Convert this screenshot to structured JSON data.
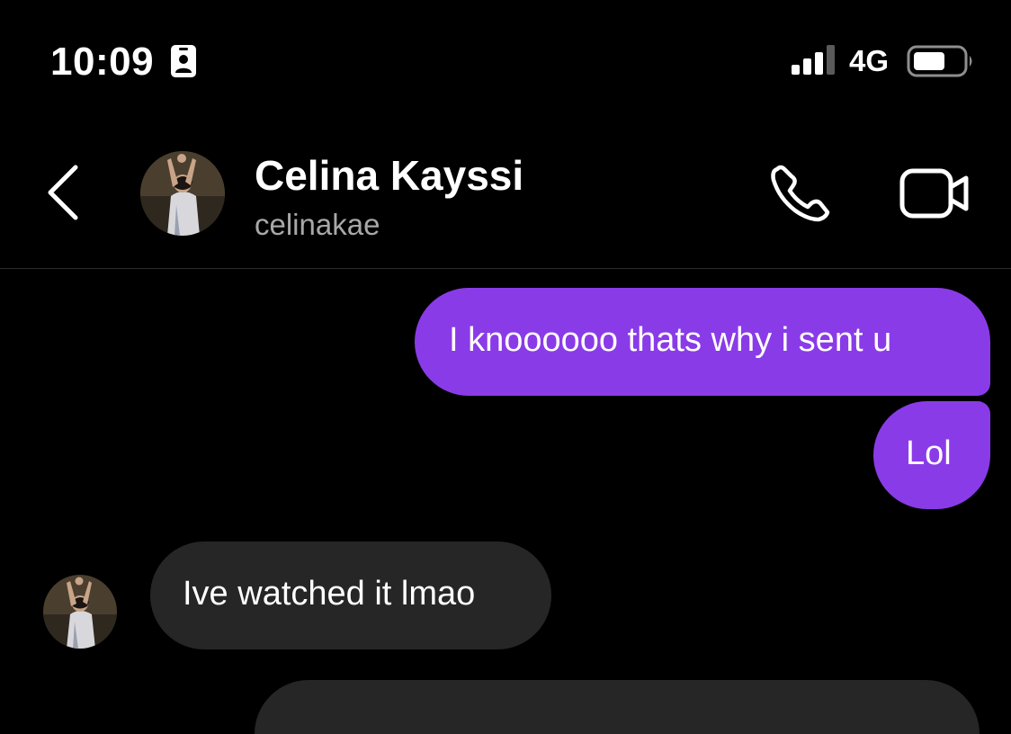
{
  "status_bar": {
    "time": "10:09",
    "network": "4G",
    "icons": [
      "contact-card-icon",
      "signal-icon",
      "battery-icon"
    ]
  },
  "header": {
    "contact_name": "Celina Kayssi",
    "username": "celinakae",
    "icons": [
      "back-chevron-icon",
      "phone-icon",
      "video-camera-icon"
    ]
  },
  "messages": [
    {
      "direction": "outgoing",
      "text": "I knoooooo thats why i sent u"
    },
    {
      "direction": "outgoing",
      "text": "Lol"
    },
    {
      "direction": "incoming",
      "text": "Ive watched it lmao"
    },
    {
      "direction": "incoming",
      "text": ""
    }
  ],
  "colors": {
    "background": "#000000",
    "outgoing_bubble": "#8a3be8",
    "incoming_bubble": "#262626",
    "secondary_text": "#a8a8a8"
  }
}
